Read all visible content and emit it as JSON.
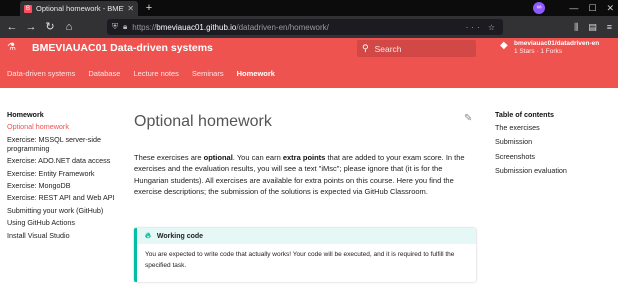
{
  "browser": {
    "tab_title": "Optional homework - BMEVIAUAC",
    "tab_favicon": "B",
    "new_tab": "+",
    "url_host": "bmeviauac01.github.io",
    "url_path": "/datadriven-en/homework/",
    "url_prefix": "https://"
  },
  "header": {
    "logo": "⚗",
    "title": "BMEVIAUAC01 Data-driven systems",
    "search_placeholder": "Search",
    "repo_name": "bmeviauac01/datadriven-en",
    "repo_stats": "1 Stars · 1 Forks",
    "tabs": [
      {
        "label": "Data-driven systems",
        "active": false
      },
      {
        "label": "Database",
        "active": false
      },
      {
        "label": "Lecture notes",
        "active": false
      },
      {
        "label": "Seminars",
        "active": false
      },
      {
        "label": "Homework",
        "active": true
      }
    ]
  },
  "leftnav": {
    "heading": "Homework",
    "items": [
      "Optional homework",
      "Exercise: MSSQL server-side programming",
      "Exercise: ADO.NET data access",
      "Exercise: Entity Framework",
      "Exercise: MongoDB",
      "Exercise: REST API and Web API",
      "Submitting your work (GitHub)",
      "Using GitHub Actions",
      "Install Visual Studio"
    ]
  },
  "main": {
    "title": "Optional homework",
    "para_1": "These exercises are ",
    "para_b1": "optional",
    "para_2": ". You can earn ",
    "para_b2": "extra points",
    "para_3": " that are added to your exam score. In the exercises and the evaluation results, you will see a text \"iMsc\"; please ignore that (it is for the Hungarian students). All exercises are available for extra points on this course. Here you find the exercise descriptions; the submission of the solutions is expected via GitHub Classroom.",
    "admonition_title": "Working code",
    "admonition_body": "You are expected to write code that actually works! Your code will be executed, and it is required to fulfill the specified task."
  },
  "toc": {
    "heading": "Table of contents",
    "items": [
      "The exercises",
      "Submission",
      "Screenshots",
      "Submission evaluation"
    ]
  },
  "colors": {
    "primary": "#ef5350",
    "accent": "#00bfa5",
    "browser_dark": "#0c0c0d",
    "toolbar": "#323234"
  }
}
